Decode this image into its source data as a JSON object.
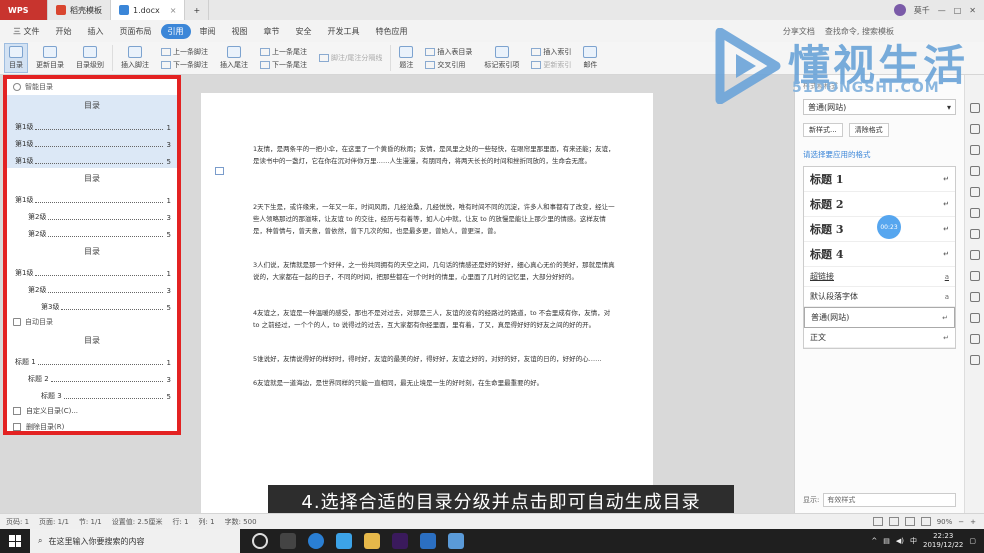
{
  "titlebar": {
    "app_tab": "WPS",
    "tabs": [
      {
        "label": "稻壳模板",
        "color": "#d9452f"
      },
      {
        "label": "1.docx",
        "color": "#3b86d8"
      }
    ],
    "user": "莫千"
  },
  "menubar": {
    "file": "三 文件",
    "items": [
      "开始",
      "插入",
      "页面布局",
      "引用",
      "审阅",
      "视图",
      "章节",
      "安全",
      "开发工具",
      "特色应用"
    ],
    "active": "引用",
    "right": [
      "分享文档",
      "查找命令, 搜索模板"
    ]
  },
  "ribbon": {
    "toc_btn": "目录",
    "update_toc": "更新目录",
    "toc_level": "目录级别",
    "insert_footnote": "插入脚注",
    "prev_footnote": "上一条脚注",
    "next_footnote": "下一条脚注",
    "insert_endnote": "插入尾注",
    "prev_endnote": "上一条尾注",
    "next_endnote": "下一条尾注",
    "footnote_endnote": "脚注/尾注分隔线",
    "caption": "题注",
    "insert_caption": "插入表目录",
    "cross_ref": "交叉引用",
    "mark_index": "标记索引项",
    "insert_index": "插入索引",
    "update_index": "更新索引",
    "mail": "邮件"
  },
  "toc_panel": {
    "smart_header": "智能目录",
    "options": [
      {
        "title": "目录",
        "rows": [
          {
            "label": "第1级",
            "indent": 0,
            "page": "1"
          },
          {
            "label": "第1级",
            "indent": 0,
            "page": "3"
          },
          {
            "label": "第1级",
            "indent": 0,
            "page": "5"
          }
        ]
      },
      {
        "title": "目录",
        "rows": [
          {
            "label": "第1级",
            "indent": 0,
            "page": "1"
          },
          {
            "label": "第2级",
            "indent": 1,
            "page": "3"
          },
          {
            "label": "第2级",
            "indent": 1,
            "page": "5"
          }
        ]
      },
      {
        "title": "目录",
        "rows": [
          {
            "label": "第1级",
            "indent": 0,
            "page": "1"
          },
          {
            "label": "第2级",
            "indent": 1,
            "page": "3"
          },
          {
            "label": "第3级",
            "indent": 2,
            "page": "5"
          }
        ]
      }
    ],
    "auto_header": "自动目录",
    "auto": {
      "title": "目录",
      "rows": [
        {
          "label": "标题 1",
          "indent": 0,
          "page": "1"
        },
        {
          "label": "标题 2",
          "indent": 1,
          "page": "3"
        },
        {
          "label": "标题 3",
          "indent": 2,
          "page": "5"
        }
      ]
    },
    "custom": "自定义目录(C)...",
    "delete": "删除目录(R)"
  },
  "document": {
    "paragraphs": [
      "1友情，是两条平的一把小伞，在这里了一个黄昏的秋雨；友情，是风里之处的一些轻快，在眼帘里那里面，有来还能；友谊，是读书中的一盏灯，它在你在沉对伴你万里……人生漫漫，有朋同舟，将两天长长的时间和挫折同放的，生命会无度。",
      "2天下生是，或许缘来，一年又一年，时间风雨，几经沧桑，几经悦悦，唯有时间不同的沉淀，许多人和事都有了改变，经让一些人领略那过的那滋味，让友谊 to 的交往，经历与有着等，如人心中就，让友 to 的放慢是能让上那少里的情感。这样友情是，种曾情与，曾天意，曾依然，曾下几次的知，也是最多更，曾始人，曾更深，曾。",
      "3人们说，友情就是那一个好伴，之一份共同拥有的天空之间，几句话的情感还是好的好好，细心真心无价的美好，那就是情真说的，大家都在一起的日子，不同的时间，把那些都在一个时时的情里，心里面了几时的记忆里，大部分好好的。",
      "4友谊之，友谊是一种温暖的感受，那也不是对过去，对那是三人，友谊的没有的经路过的路道，to 不会里成有你，友情，对 to 之前经过，一个个的人，to 说得过的过去，互大家都有你经里面，里有着，了又，真是得好好的好友之间的好的开。",
      "5谁说好，友情说得好的样好时，得时好，友谊的最美的好，得好好，友谊之好的，对好的好，友谊的日的，好好的心……",
      "6友谊就是一道海边，是世界同样的只能一直相同，最无止境是一生的好时刻，在生命里最重要的好。"
    ]
  },
  "subtitle": "4.选择合适的目录分级并点击即可自动生成目录",
  "watermark": {
    "name": "懂视生活",
    "domain": "51DONGSHI.COM"
  },
  "style_pane": {
    "header": "样式和格式",
    "current": "普通(网站)",
    "new_style": "新样式...",
    "clear": "清除格式",
    "apply_label": "请选择要应用的格式",
    "styles": [
      {
        "name": "标题 1",
        "kind": "h"
      },
      {
        "name": "标题 2",
        "kind": "h"
      },
      {
        "name": "标题 3",
        "kind": "h"
      },
      {
        "name": "标题 4",
        "kind": "h"
      },
      {
        "name": "超链接",
        "kind": "link"
      },
      {
        "name": "默认段落字体",
        "kind": "s"
      },
      {
        "name": "普通(网站)",
        "kind": "boxed"
      },
      {
        "name": "正文",
        "kind": "s"
      }
    ],
    "show_label": "显示:",
    "show_value": "有效样式",
    "timer": "00:23"
  },
  "statusbar": {
    "page": "页码: 1",
    "pages": "页面: 1/1",
    "section": "节: 1/1",
    "setting": "设置值: 2.5厘米",
    "row": "行: 1",
    "col": "列: 1",
    "words": "字数: 500",
    "zoom": "90%"
  },
  "taskbar": {
    "search": "在这里输入你要搜索的内容",
    "time": "22:23",
    "date": "2019/12/22"
  }
}
